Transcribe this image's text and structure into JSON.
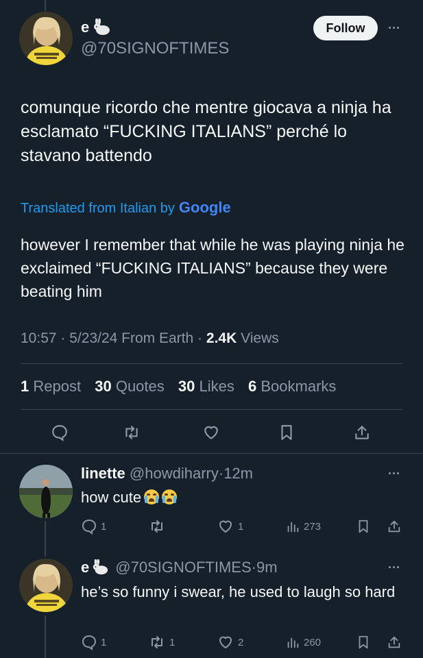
{
  "main_tweet": {
    "display_name": "e",
    "handle": "@70SIGNOFTIMES",
    "follow_label": "Follow",
    "text": "comunque ricordo che mentre giocava a ninja ha esclamato “FUCKING ITALIANS” perché lo stavano battendo",
    "translated_label": "Translated from Italian by",
    "google_label": "Google",
    "translation": "however I remember that while he was playing ninja he exclaimed “FUCKING ITALIANS” because they were beating him",
    "meta": {
      "time": "10:57",
      "date": "5/23/24",
      "source": "From Earth",
      "views_count": "2.4K",
      "views_label": "Views",
      "sep": "·"
    },
    "stats": {
      "reposts_count": "1",
      "reposts_label": "Repost",
      "quotes_count": "30",
      "quotes_label": "Quotes",
      "likes_count": "30",
      "likes_label": "Likes",
      "bookmarks_count": "6",
      "bookmarks_label": "Bookmarks"
    }
  },
  "replies": [
    {
      "display_name": "linette",
      "handle": "@howdiharry",
      "sep": "·",
      "time": "12m",
      "text": "how cute",
      "reply_count": "1",
      "repost_count": "",
      "like_count": "1",
      "views": "273"
    },
    {
      "display_name": "e",
      "handle": "@70SIGNOFTIMES",
      "sep": "·",
      "time": "9m",
      "text": "he’s so funny i swear, he used to laugh so hard",
      "reply_count": "1",
      "repost_count": "1",
      "like_count": "2",
      "views": "260"
    }
  ],
  "colors": {
    "background": "#15202b",
    "muted": "#8b98a5",
    "link": "#1d9bf0",
    "divider": "#38444d"
  }
}
